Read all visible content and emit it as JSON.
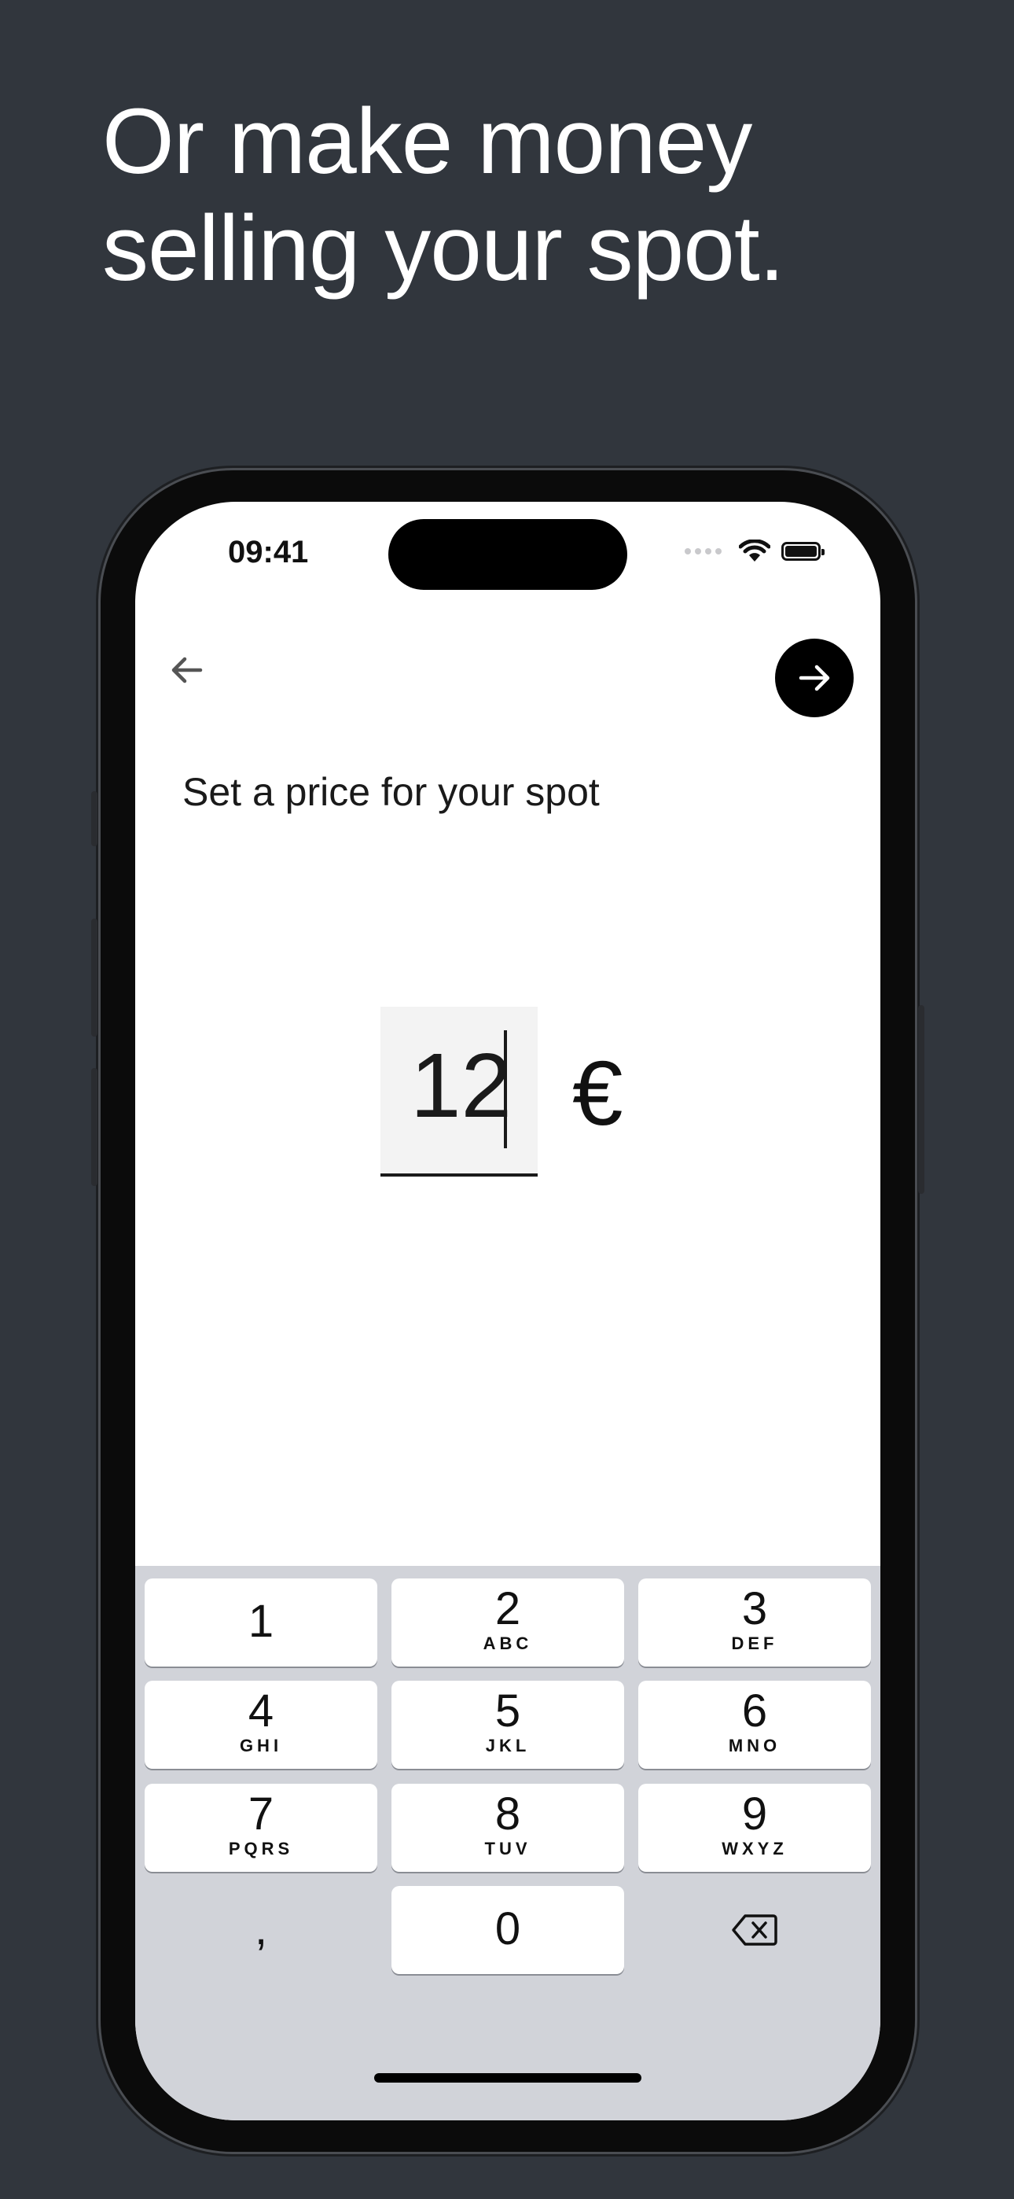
{
  "headline": {
    "line1": "Or make money",
    "line2": "selling your spot."
  },
  "status_bar": {
    "time": "09:41"
  },
  "screen": {
    "prompt": "Set a price for your spot",
    "amount": "12",
    "currency": "€"
  },
  "icons": {
    "back": "arrow-left-icon",
    "next": "arrow-right-icon",
    "wifi": "wifi-icon",
    "battery": "battery-icon",
    "delete": "backspace-icon"
  },
  "keypad": {
    "keys": [
      {
        "digit": "1",
        "letters": ""
      },
      {
        "digit": "2",
        "letters": "ABC"
      },
      {
        "digit": "3",
        "letters": "DEF"
      },
      {
        "digit": "4",
        "letters": "GHI"
      },
      {
        "digit": "5",
        "letters": "JKL"
      },
      {
        "digit": "6",
        "letters": "MNO"
      },
      {
        "digit": "7",
        "letters": "PQRS"
      },
      {
        "digit": "8",
        "letters": "TUV"
      },
      {
        "digit": "9",
        "letters": "WXYZ"
      }
    ],
    "comma": ",",
    "zero": "0"
  },
  "colors": {
    "page_background": "#31363d",
    "keypad_background": "#d1d3d9",
    "accent": "#000000"
  }
}
